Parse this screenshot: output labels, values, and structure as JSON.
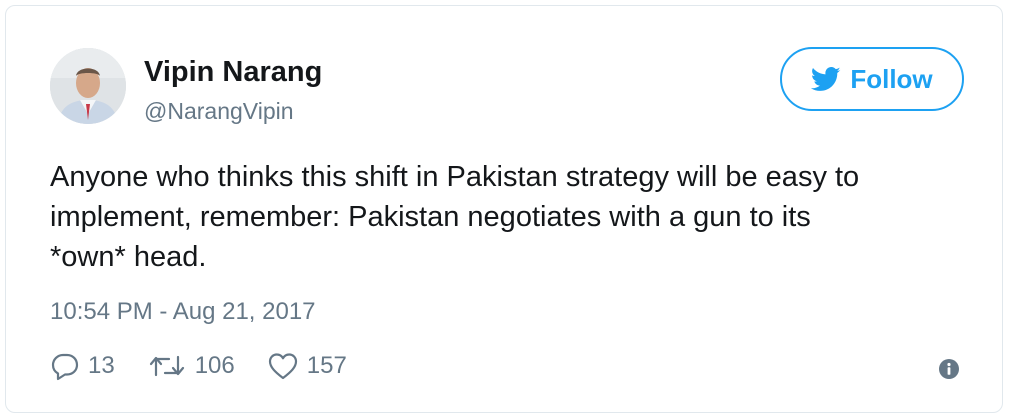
{
  "author": {
    "display_name": "Vipin Narang",
    "handle": "@NarangVipin",
    "avatar_icon": "profile-photo"
  },
  "follow_button": {
    "label": "Follow",
    "icon": "twitter-bird-icon",
    "color": "#1da1f2"
  },
  "tweet": {
    "text": "Anyone who thinks this shift in Pakistan strategy will be easy to\nimplement, remember: Pakistan negotiates with a gun to its\n*own* head.",
    "timestamp": "10:54 PM - Aug 21, 2017"
  },
  "actions": {
    "reply": {
      "icon": "reply-icon",
      "count": "13"
    },
    "retweet": {
      "icon": "retweet-icon",
      "count": "106"
    },
    "like": {
      "icon": "heart-icon",
      "count": "157"
    },
    "info": {
      "icon": "info-icon"
    }
  },
  "colors": {
    "text": "#14171a",
    "secondary": "#657786",
    "border": "#e1e8ed",
    "accent": "#1da1f2"
  }
}
